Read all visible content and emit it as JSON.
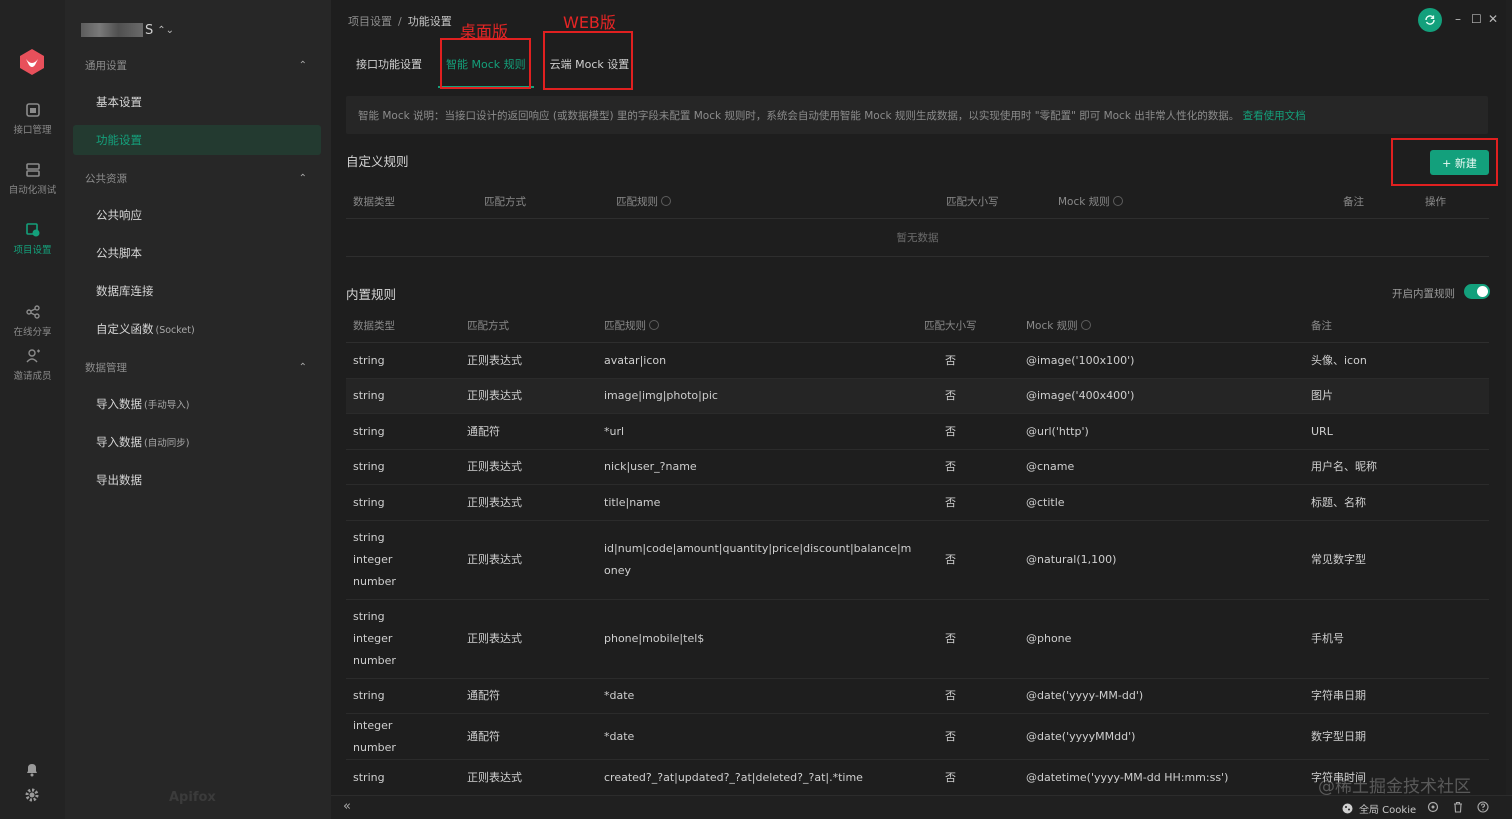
{
  "rail": {
    "items": [
      {
        "label": "接口管理",
        "icon": "api-icon"
      },
      {
        "label": "自动化测试",
        "icon": "automation-icon"
      },
      {
        "label": "项目设置",
        "icon": "project-settings-icon"
      },
      {
        "label": "在线分享",
        "icon": "share-icon"
      },
      {
        "label": "邀请成员",
        "icon": "invite-icon"
      }
    ],
    "bottom": [
      {
        "icon": "bell-icon"
      },
      {
        "icon": "gear-icon"
      }
    ]
  },
  "sidebar": {
    "project_suffix": "S",
    "sections": [
      {
        "title": "通用设置",
        "items": [
          {
            "label": "基本设置"
          },
          {
            "label": "功能设置",
            "active": true
          }
        ]
      },
      {
        "title": "公共资源",
        "items": [
          {
            "label": "公共响应"
          },
          {
            "label": "公共脚本"
          },
          {
            "label": "数据库连接"
          },
          {
            "label": "自定义函数",
            "sub": "(Socket)"
          }
        ]
      },
      {
        "title": "数据管理",
        "items": [
          {
            "label": "导入数据",
            "sub": "(手动导入)"
          },
          {
            "label": "导入数据",
            "sub": "(自动同步)"
          },
          {
            "label": "导出数据"
          }
        ]
      }
    ],
    "watermark": "Apifox"
  },
  "header": {
    "breadcrumb": [
      "项目设置",
      "功能设置"
    ],
    "sep": "/",
    "window_controls": [
      "–",
      "☐",
      "✕"
    ]
  },
  "tabs": [
    {
      "label": "接口功能设置"
    },
    {
      "label": "智能 Mock 规则",
      "active": true
    },
    {
      "label": "云端 Mock 设置"
    }
  ],
  "annotations": {
    "desktop": "桌面版",
    "web": "WEB版"
  },
  "notice": {
    "text": "智能 Mock 说明：当接口设计的返回响应 (或数据模型) 里的字段未配置 Mock 规则时，系统会自动使用智能 Mock 规则生成数据，以实现使用时 \"零配置\" 即可 Mock 出非常人性化的数据。",
    "link": "查看使用文档"
  },
  "custom_rules": {
    "title": "自定义规则",
    "new_button": "+ 新建",
    "columns": [
      "数据类型",
      "匹配方式",
      "匹配规则",
      "匹配大小写",
      "Mock 规则",
      "备注",
      "操作"
    ],
    "empty": "暂无数据"
  },
  "builtin_rules": {
    "title": "内置规则",
    "toggle_label": "开启内置规则",
    "toggle_on": true,
    "columns": [
      "数据类型",
      "匹配方式",
      "匹配规则",
      "匹配大小写",
      "Mock 规则",
      "备注"
    ],
    "rows": [
      {
        "type": [
          "string"
        ],
        "method": "正则表达式",
        "rule": [
          "avatar|icon"
        ],
        "case": "否",
        "mock": "@image('100x100')",
        "note": "头像、icon"
      },
      {
        "type": [
          "string"
        ],
        "method": "正则表达式",
        "rule": [
          "image|img|photo|pic"
        ],
        "case": "否",
        "mock": "@image('400x400')",
        "note": "图片"
      },
      {
        "type": [
          "string"
        ],
        "method": "通配符",
        "rule": [
          "*url"
        ],
        "case": "否",
        "mock": "@url('http')",
        "note": "URL"
      },
      {
        "type": [
          "string"
        ],
        "method": "正则表达式",
        "rule": [
          "nick|user_?name"
        ],
        "case": "否",
        "mock": "@cname",
        "note": "用户名、昵称"
      },
      {
        "type": [
          "string"
        ],
        "method": "正则表达式",
        "rule": [
          "title|name"
        ],
        "case": "否",
        "mock": "@ctitle",
        "note": "标题、名称"
      },
      {
        "type": [
          "string",
          "integer",
          "number"
        ],
        "method": "正则表达式",
        "rule": [
          "id|num|code|amount|quantity|price|discount|balance|m",
          "oney"
        ],
        "case": "否",
        "mock": "@natural(1,100)",
        "note": "常见数字型"
      },
      {
        "type": [
          "string",
          "integer",
          "number"
        ],
        "method": "正则表达式",
        "rule": [
          "phone|mobile|tel$"
        ],
        "case": "否",
        "mock": "@phone",
        "note": "手机号"
      },
      {
        "type": [
          "string"
        ],
        "method": "通配符",
        "rule": [
          "*date"
        ],
        "case": "否",
        "mock": "@date('yyyy-MM-dd')",
        "note": "字符串日期"
      },
      {
        "type": [
          "integer",
          "number"
        ],
        "method": "通配符",
        "rule": [
          "*date"
        ],
        "case": "否",
        "mock": "@date('yyyyMMdd')",
        "note": "数字型日期"
      },
      {
        "type": [
          "string"
        ],
        "method": "正则表达式",
        "rule": [
          "created?_?at|updated?_?at|deleted?_?at|.*time"
        ],
        "case": "否",
        "mock": "@datetime('yyyy-MM-dd HH:mm:ss')",
        "note": "字符串时间"
      }
    ]
  },
  "statusbar": {
    "collapse": "«",
    "cookie": "全局 Cookie"
  },
  "page_watermark": "@稀土掘金技术社区",
  "colors": {
    "accent": "#13a07c",
    "annotation": "#e02020",
    "background": "#1e1e1e"
  }
}
